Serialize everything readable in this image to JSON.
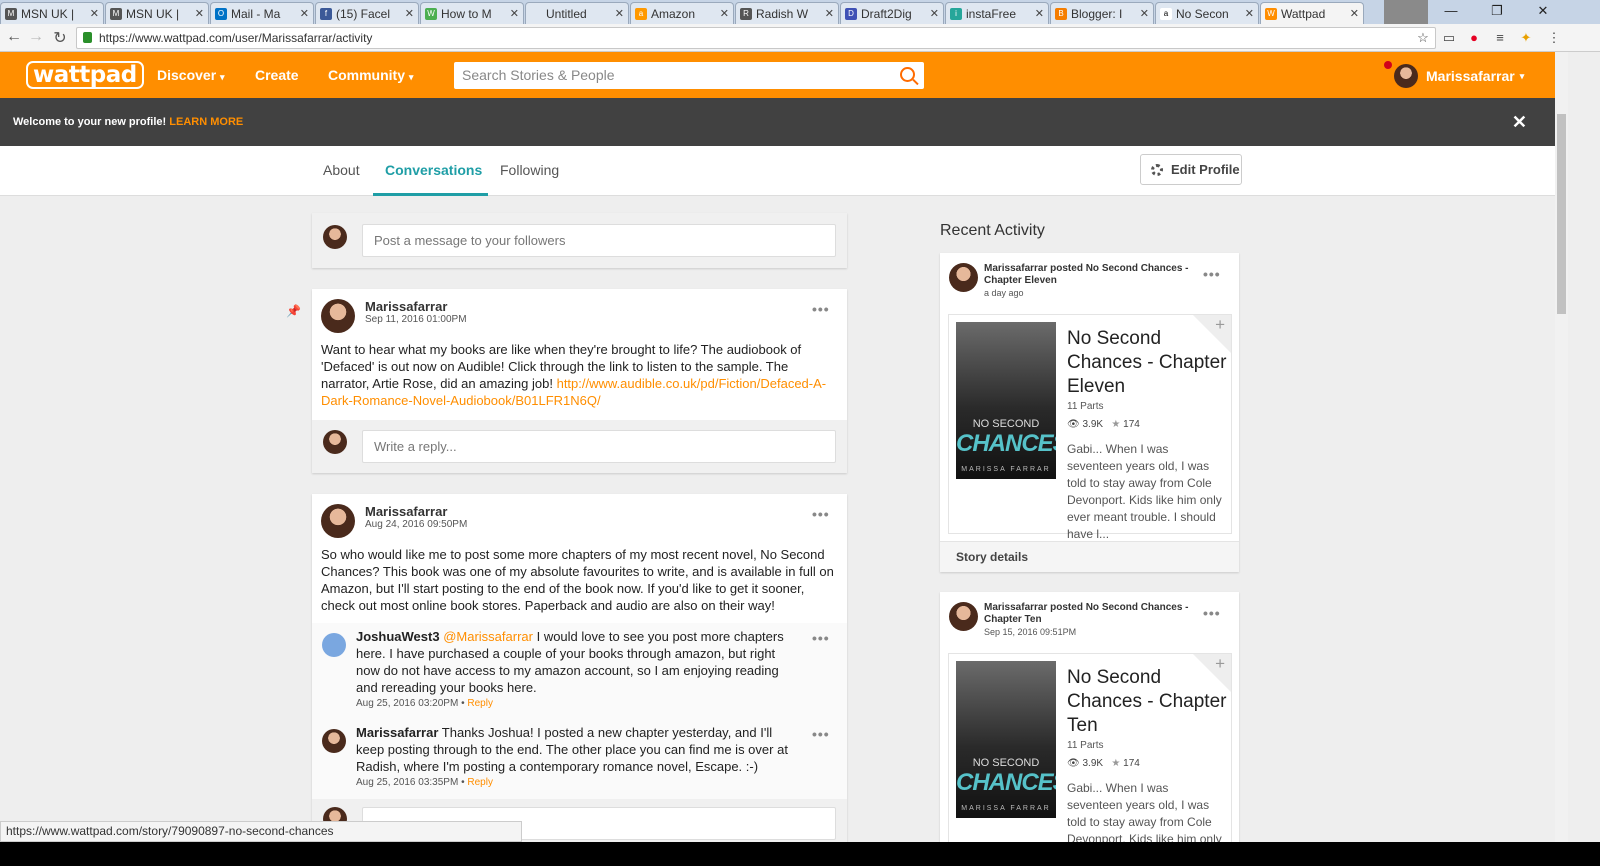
{
  "browser": {
    "tabs": [
      {
        "title": "MSN UK |",
        "fav": "M"
      },
      {
        "title": "MSN UK |",
        "fav": "M"
      },
      {
        "title": "Mail - Ma",
        "fav": "O"
      },
      {
        "title": "(15) Facel",
        "fav": "f"
      },
      {
        "title": "How to M",
        "fav": "W"
      },
      {
        "title": "Untitled",
        "fav": ""
      },
      {
        "title": "Amazon",
        "fav": "a"
      },
      {
        "title": "Radish W",
        "fav": "R"
      },
      {
        "title": "Draft2Dig",
        "fav": "D"
      },
      {
        "title": "instaFree",
        "fav": "i"
      },
      {
        "title": "Blogger: I",
        "fav": "B"
      },
      {
        "title": "No Secon",
        "fav": "a"
      },
      {
        "title": "Wattpad",
        "fav": "W"
      }
    ],
    "url": "https://www.wattpad.com/user/Marissafarrar/activity",
    "status_url": "https://www.wattpad.com/story/79090897-no-second-chances"
  },
  "header": {
    "logo": "wattpad",
    "nav": [
      "Discover",
      "Create",
      "Community"
    ],
    "search_placeholder": "Search Stories & People",
    "username": "Marissafarrar"
  },
  "banner": {
    "text": "Welcome to your new profile!",
    "learn_more": "LEARN MORE",
    "close": "✕"
  },
  "profile_tabs": {
    "about": "About",
    "conversations": "Conversations",
    "following": "Following",
    "edit_profile": "Edit Profile"
  },
  "composer": {
    "placeholder": "Post a message to your followers"
  },
  "posts": [
    {
      "author": "Marissafarrar",
      "date": "Sep 11, 2016 01:00PM",
      "body": "Want to hear what my books are like when they're brought to life? The audiobook of 'Defaced' is out now on Audible! Click through the link to listen to the sample. The narrator, Artie Rose, did an amazing job!",
      "link": "http://www.audible.co.uk/pd/Fiction/Defaced-A-Dark-Romance-Novel-Audiobook/B01LFR1N6Q/",
      "reply_placeholder": "Write a reply..."
    },
    {
      "author": "Marissafarrar",
      "date": "Aug 24, 2016 09:50PM",
      "body": "So who would like me to post some more chapters of my most recent novel, No Second Chances? This book was one of my absolute favourites to write, and is available in full on Amazon, but I'll start posting to the end of the book now. If you'd like to get it sooner, check out most online book stores. Paperback and audio are also on their way!",
      "comments": [
        {
          "author": "JoshuaWest3",
          "mention": "@Marissafarrar",
          "text": "I would love to see you post more chapters here. I have purchased a couple of your books through amazon, but right now do not have access to my amazon account, so I am enjoying reading and rereading your books here.",
          "date": "Aug 25, 2016 03:20PM",
          "reply": "Reply"
        },
        {
          "author": "Marissafarrar",
          "mention": "",
          "text": "Thanks Joshua! I posted a new chapter yesterday, and I'll keep posting through to the end. The other place you can find me is over at Radish, where I'm posting a contemporary romance novel, Escape. :-)",
          "date": "Aug 25, 2016 03:35PM",
          "reply": "Reply"
        }
      ]
    }
  ],
  "recent_activity": {
    "title": "Recent Activity",
    "items": [
      {
        "headline": "Marissafarrar posted No Second Chances - Chapter Eleven",
        "time": "a day ago",
        "story_title": "No Second Chances - Chapter Eleven",
        "parts": "11 Parts",
        "reads": "3.9K",
        "votes": "174",
        "desc": "Gabi... When I was seventeen years old, I was told to stay away from Cole Devonport. Kids like him only ever meant trouble. I should have l...",
        "details": "Story details"
      },
      {
        "headline": "Marissafarrar posted No Second Chances - Chapter Ten",
        "time": "Sep 15, 2016 09:51PM",
        "story_title": "No Second Chances - Chapter Ten",
        "parts": "11 Parts",
        "reads": "3.9K",
        "votes": "174",
        "desc": "Gabi... When I was seventeen years old, I was told to stay away from Cole Devonport. Kids like him only ever meant"
      }
    ],
    "cover": {
      "line1": "NO SECOND",
      "line2": "CHANCES",
      "author": "MARISSA FARRAR"
    }
  },
  "colors": {
    "brand": "#ff8e00",
    "accent": "#1f9ea6",
    "banner": "#414141"
  }
}
